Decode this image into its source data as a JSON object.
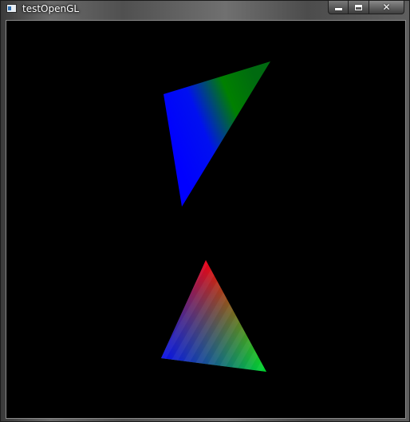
{
  "window": {
    "title": "testOpenGL",
    "icons": {
      "app": "app-window-icon",
      "minimize": "minimize-icon",
      "maximize": "maximize-icon",
      "close": "close-icon"
    },
    "controls": {
      "close_glyph": "✕"
    }
  },
  "scene": {
    "background_color": "#000000",
    "upper_triangle": {
      "vertex_colors": [
        "#0000ff",
        "#008000",
        "#0000ff"
      ]
    },
    "lower_triangle": {
      "vertex_colors": [
        "#ff0000",
        "#0000ff",
        "#00ff00"
      ]
    }
  }
}
